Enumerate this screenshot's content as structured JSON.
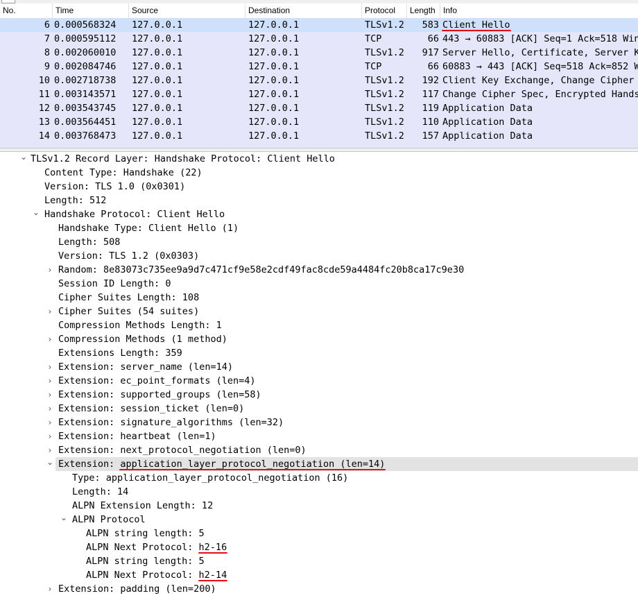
{
  "packet_list": {
    "columns": [
      "No.",
      "Time",
      "Source",
      "Destination",
      "Protocol",
      "Length",
      "Info"
    ],
    "rows": [
      {
        "no": "6",
        "time": "0.000568324",
        "src": "127.0.0.1",
        "dst": "127.0.0.1",
        "proto": "TLSv1.2",
        "len": "583",
        "info": "Client Hello"
      },
      {
        "no": "7",
        "time": "0.000595112",
        "src": "127.0.0.1",
        "dst": "127.0.0.1",
        "proto": "TCP",
        "len": "66",
        "info": "443 → 60883 [ACK] Seq=1 Ack=518 Win="
      },
      {
        "no": "8",
        "time": "0.002060010",
        "src": "127.0.0.1",
        "dst": "127.0.0.1",
        "proto": "TLSv1.2",
        "len": "917",
        "info": "Server Hello, Certificate, Server Ke"
      },
      {
        "no": "9",
        "time": "0.002084746",
        "src": "127.0.0.1",
        "dst": "127.0.0.1",
        "proto": "TCP",
        "len": "66",
        "info": "60883 → 443 [ACK] Seq=518 Ack=852 Wi"
      },
      {
        "no": "10",
        "time": "0.002718738",
        "src": "127.0.0.1",
        "dst": "127.0.0.1",
        "proto": "TLSv1.2",
        "len": "192",
        "info": "Client Key Exchange, Change Cipher S"
      },
      {
        "no": "11",
        "time": "0.003143571",
        "src": "127.0.0.1",
        "dst": "127.0.0.1",
        "proto": "TLSv1.2",
        "len": "117",
        "info": "Change Cipher Spec, Encrypted Handsh"
      },
      {
        "no": "12",
        "time": "0.003543745",
        "src": "127.0.0.1",
        "dst": "127.0.0.1",
        "proto": "TLSv1.2",
        "len": "119",
        "info": "Application Data"
      },
      {
        "no": "13",
        "time": "0.003564451",
        "src": "127.0.0.1",
        "dst": "127.0.0.1",
        "proto": "TLSv1.2",
        "len": "110",
        "info": "Application Data"
      },
      {
        "no": "14",
        "time": "0.003768473",
        "src": "127.0.0.1",
        "dst": "127.0.0.1",
        "proto": "TLSv1.2",
        "len": "157",
        "info": "Application Data"
      }
    ],
    "selected_row": 0
  },
  "details": [
    {
      "text": "TLSv1.2 Record Layer: Handshake Protocol: Client Hello",
      "depth": 0,
      "expander": "expanded"
    },
    {
      "text": "Content Type: Handshake (22)",
      "depth": 1,
      "expander": "none"
    },
    {
      "text": "Version: TLS 1.0 (0x0301)",
      "depth": 1,
      "expander": "none"
    },
    {
      "text": "Length: 512",
      "depth": 1,
      "expander": "none"
    },
    {
      "text": "Handshake Protocol: Client Hello",
      "depth": 1,
      "expander": "expanded"
    },
    {
      "text": "Handshake Type: Client Hello (1)",
      "depth": 2,
      "expander": "none"
    },
    {
      "text": "Length: 508",
      "depth": 2,
      "expander": "none"
    },
    {
      "text": "Version: TLS 1.2 (0x0303)",
      "depth": 2,
      "expander": "none"
    },
    {
      "text": "Random: 8e83073c735ee9a9d7c471cf9e58e2cdf49fac8cde59a4484fc20b8ca17c9e30",
      "depth": 2,
      "expander": "collapsed"
    },
    {
      "text": "Session ID Length: 0",
      "depth": 2,
      "expander": "none"
    },
    {
      "text": "Cipher Suites Length: 108",
      "depth": 2,
      "expander": "none"
    },
    {
      "text": "Cipher Suites (54 suites)",
      "depth": 2,
      "expander": "collapsed"
    },
    {
      "text": "Compression Methods Length: 1",
      "depth": 2,
      "expander": "none"
    },
    {
      "text": "Compression Methods (1 method)",
      "depth": 2,
      "expander": "collapsed"
    },
    {
      "text": "Extensions Length: 359",
      "depth": 2,
      "expander": "none"
    },
    {
      "text": "Extension: server_name (len=14)",
      "depth": 2,
      "expander": "collapsed"
    },
    {
      "text": "Extension: ec_point_formats (len=4)",
      "depth": 2,
      "expander": "collapsed"
    },
    {
      "text": "Extension: supported_groups (len=58)",
      "depth": 2,
      "expander": "collapsed"
    },
    {
      "text": "Extension: session_ticket (len=0)",
      "depth": 2,
      "expander": "collapsed"
    },
    {
      "text": "Extension: signature_algorithms (len=32)",
      "depth": 2,
      "expander": "collapsed"
    },
    {
      "text": "Extension: heartbeat (len=1)",
      "depth": 2,
      "expander": "collapsed"
    },
    {
      "text": "Extension: next_protocol_negotiation (len=0)",
      "depth": 2,
      "expander": "collapsed"
    },
    {
      "text": "Extension: application_layer_protocol_negotiation (len=14)",
      "depth": 2,
      "expander": "expanded",
      "highlighted": true
    },
    {
      "text": "Type: application_layer_protocol_negotiation (16)",
      "depth": 3,
      "expander": "none"
    },
    {
      "text": "Length: 14",
      "depth": 3,
      "expander": "none"
    },
    {
      "text": "ALPN Extension Length: 12",
      "depth": 3,
      "expander": "none"
    },
    {
      "text": "ALPN Protocol",
      "depth": 3,
      "expander": "expanded"
    },
    {
      "text": "ALPN string length: 5",
      "depth": 4,
      "expander": "none"
    },
    {
      "text": "ALPN Next Protocol: h2-16",
      "depth": 4,
      "expander": "none"
    },
    {
      "text": "ALPN string length: 5",
      "depth": 4,
      "expander": "none"
    },
    {
      "text": "ALPN Next Protocol: h2-14",
      "depth": 4,
      "expander": "none"
    },
    {
      "text": "Extension: padding (len=200)",
      "depth": 2,
      "expander": "collapsed"
    }
  ],
  "annotations": {
    "underline_color": "#e01010",
    "underlined": [
      "Client Hello",
      "application_layer_protocol_negotiation (len=14)",
      "h2-16",
      "h2-14"
    ]
  },
  "colors": {
    "packet_row_bg": "#e6e6fa",
    "selected_row_bg": "#cfe0fa",
    "highlight_tree_bg": "#e3e3e3"
  }
}
